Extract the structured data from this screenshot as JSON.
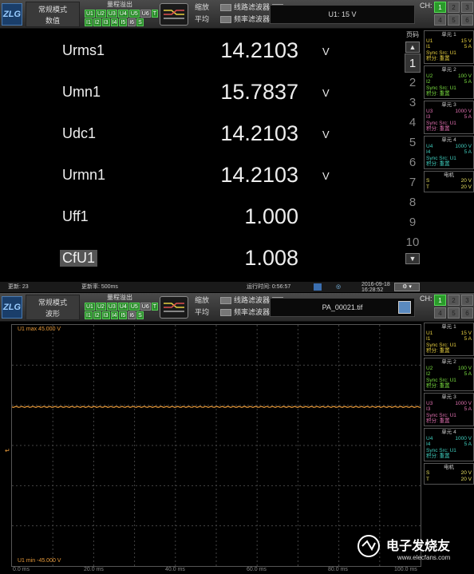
{
  "top_toolbar": {
    "logo": "ZLG",
    "mode_line1": "常规模式",
    "mode_line2": "数值",
    "range_title": "量程溢出",
    "range_row1": [
      "U1",
      "U2",
      "U3",
      "U4",
      "U5",
      "U6",
      "T"
    ],
    "range_row2": [
      "I1",
      "I2",
      "I3",
      "I4",
      "I5",
      "I6",
      "S"
    ],
    "zoom_label": "缩放",
    "avg_label": "平均",
    "line_filter_label": "线路滤波器",
    "freq_filter_label": "频率滤波器",
    "display_text": "U1: 15 V",
    "ch_label": "CH:",
    "ch_buttons": [
      "1",
      "2",
      "3",
      "4",
      "5",
      "6"
    ]
  },
  "numeric": {
    "rows": [
      {
        "name": "Urms1",
        "value": "14.2103",
        "unit": "V"
      },
      {
        "name": "Umn1",
        "value": "15.7837",
        "unit": "V"
      },
      {
        "name": "Udc1",
        "value": "14.2103",
        "unit": "V"
      },
      {
        "name": "Urmn1",
        "value": "14.2103",
        "unit": "V"
      },
      {
        "name": "Uff1",
        "value": "1.000",
        "unit": ""
      },
      {
        "name": "CfU1",
        "value": "1.008",
        "unit": ""
      }
    ]
  },
  "pager": {
    "title": "页码",
    "up": "▲",
    "down": "▼",
    "pages": [
      "1",
      "2",
      "3",
      "4",
      "5",
      "6",
      "7",
      "8",
      "9",
      "10"
    ],
    "selected": "1"
  },
  "sidebar_top": [
    {
      "title": "单元 1",
      "l1": "U1",
      "v1": "15 V",
      "l2": "I1",
      "v2": "5 A",
      "sync": "Sync Src: U1",
      "integ": "积分: 重置",
      "color": "#e8d040"
    },
    {
      "title": "单元 2",
      "l1": "U2",
      "v1": "100 V",
      "l2": "I2",
      "v2": "5 A",
      "sync": "Sync Src: U1",
      "integ": "积分: 重置",
      "color": "#7adf40"
    },
    {
      "title": "单元 3",
      "l1": "U3",
      "v1": "1000 V",
      "l2": "I3",
      "v2": "5 A",
      "sync": "Sync Src: U1",
      "integ": "积分: 重置",
      "color": "#e070b0"
    },
    {
      "title": "单元 4",
      "l1": "U4",
      "v1": "1000 V",
      "l2": "I4",
      "v2": "5 A",
      "sync": "Sync Src: U1",
      "integ": "积分: 重置",
      "color": "#40d0c0"
    },
    {
      "title": "电机",
      "l1": "S",
      "v1": "20 V",
      "l2": "T",
      "v2": "20 V",
      "sync": "",
      "integ": "",
      "color": "#e8e060"
    }
  ],
  "status": {
    "update": "更新: 23",
    "rate": "更新率: 500ms",
    "run_time": "运行时间: 0:56:57",
    "date": "2016-09-18",
    "time": "16:28:52"
  },
  "bottom_toolbar": {
    "logo": "ZLG",
    "mode_line1": "常规模式",
    "mode_line2": "波形",
    "range_title": "量程溢出",
    "zoom_label": "缩放",
    "avg_label": "平均",
    "line_filter_label": "线路滤波器",
    "freq_filter_label": "频率滤波器",
    "display_text": "PA_00021.tif",
    "ch_label": "CH:"
  },
  "sidebar_bottom": [
    {
      "title": "单元 1",
      "l1": "U1",
      "v1": "15 V",
      "l2": "I1",
      "v2": "5 A",
      "sync": "Sync Src: U1",
      "integ": "积分: 重置",
      "color": "#e8d040"
    },
    {
      "title": "单元 2",
      "l1": "U2",
      "v1": "100 V",
      "l2": "I2",
      "v2": "5 A",
      "sync": "Sync Src: U1",
      "integ": "积分: 重置",
      "color": "#7adf40"
    },
    {
      "title": "单元 3",
      "l1": "U3",
      "v1": "1000 V",
      "l2": "I3",
      "v2": "5 A",
      "sync": "Sync Src: U1",
      "integ": "积分: 重置",
      "color": "#e070b0"
    },
    {
      "title": "单元 4",
      "l1": "U4",
      "v1": "1000 V",
      "l2": "I4",
      "v2": "5 A",
      "sync": "Sync Src: U1",
      "integ": "积分: 重置",
      "color": "#40d0c0"
    },
    {
      "title": "电机",
      "l1": "S",
      "v1": "20 V",
      "l2": "T",
      "v2": "20 V",
      "sync": "",
      "integ": "",
      "color": "#e8e060"
    }
  ],
  "waveform": {
    "max_label": "U1  max 45.000 V",
    "min_label": "U1  min -45.000 V",
    "trace_color": "#e89a3a",
    "level_fraction": 0.66,
    "x_ticks": [
      "0.0 ms",
      "20.0 ms",
      "40.0 ms",
      "60.0 ms",
      "80.0 ms",
      "100.0 ms"
    ]
  },
  "watermark": {
    "text": "电子发烧友",
    "url": "www.elecfans.com"
  }
}
